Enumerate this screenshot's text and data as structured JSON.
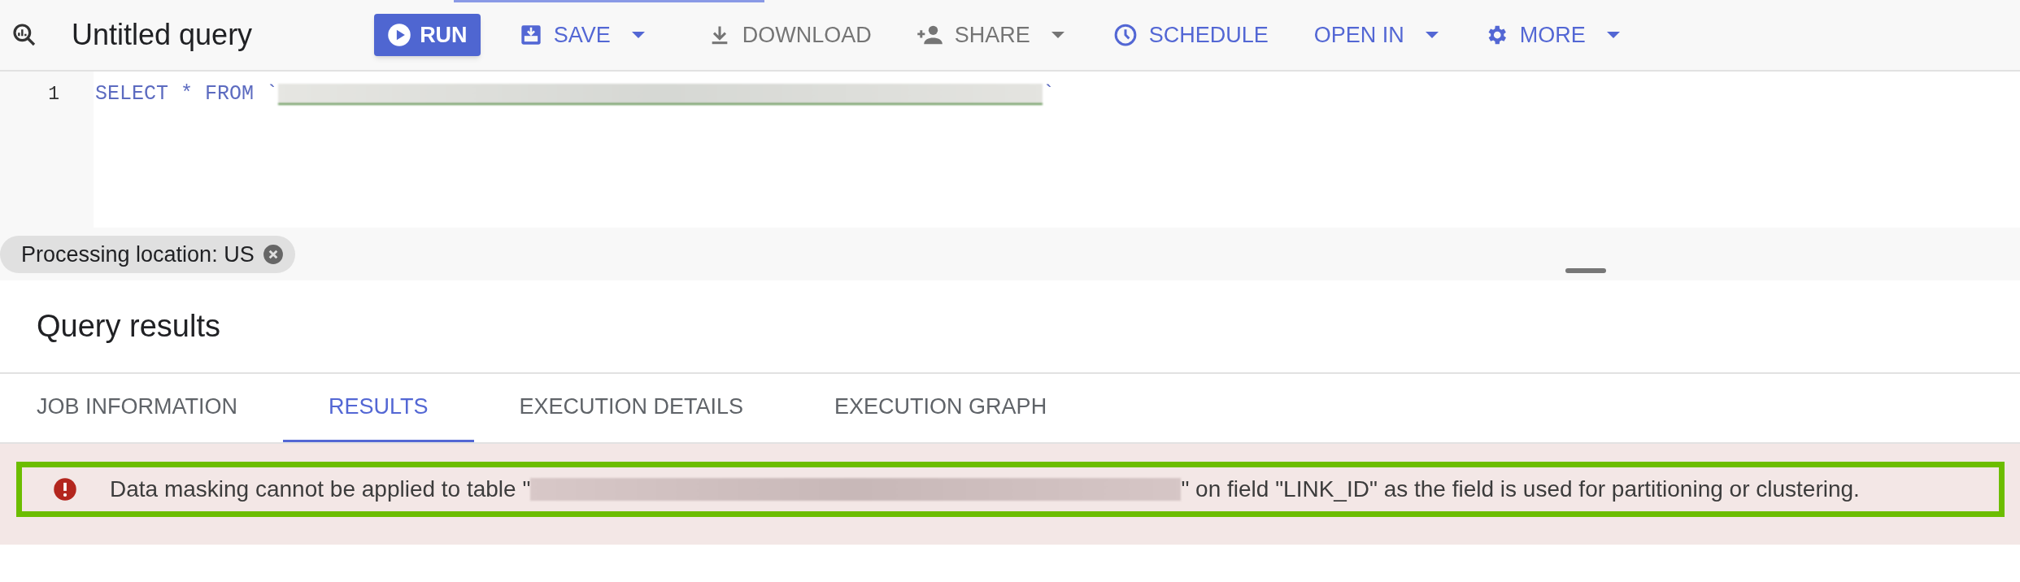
{
  "query": {
    "title": "Untitled query"
  },
  "toolbar": [
    {
      "label": "RUN",
      "kind": "primary",
      "disabled": false,
      "has_menu": false
    },
    {
      "label": "SAVE",
      "kind": "action",
      "disabled": false,
      "has_menu": true
    },
    {
      "label": "DOWNLOAD",
      "kind": "action",
      "disabled": true,
      "has_menu": false
    },
    {
      "label": "SHARE",
      "kind": "action",
      "disabled": true,
      "has_menu": true
    },
    {
      "label": "SCHEDULE",
      "kind": "action",
      "disabled": false,
      "has_menu": false
    },
    {
      "label": "OPEN IN",
      "kind": "action",
      "disabled": false,
      "has_menu": true
    },
    {
      "label": "MORE",
      "kind": "action",
      "disabled": false,
      "has_menu": true
    }
  ],
  "editor": {
    "lines": [
      {
        "number": "1",
        "code_before": "SELECT * FROM `",
        "code_after": "`"
      }
    ]
  },
  "processing_chip": {
    "label": "Processing location: US"
  },
  "results": {
    "title": "Query results",
    "tabs": [
      {
        "label": "JOB INFORMATION",
        "selected": false
      },
      {
        "label": "RESULTS",
        "selected": true
      },
      {
        "label": "EXECUTION DETAILS",
        "selected": false
      },
      {
        "label": "EXECUTION GRAPH",
        "selected": false
      }
    ],
    "error": {
      "kind": "error",
      "message_before": "Data masking cannot be applied to table \"",
      "message_after": "\" on field \"LINK_ID\" as the field is used for partitioning or clustering."
    }
  }
}
